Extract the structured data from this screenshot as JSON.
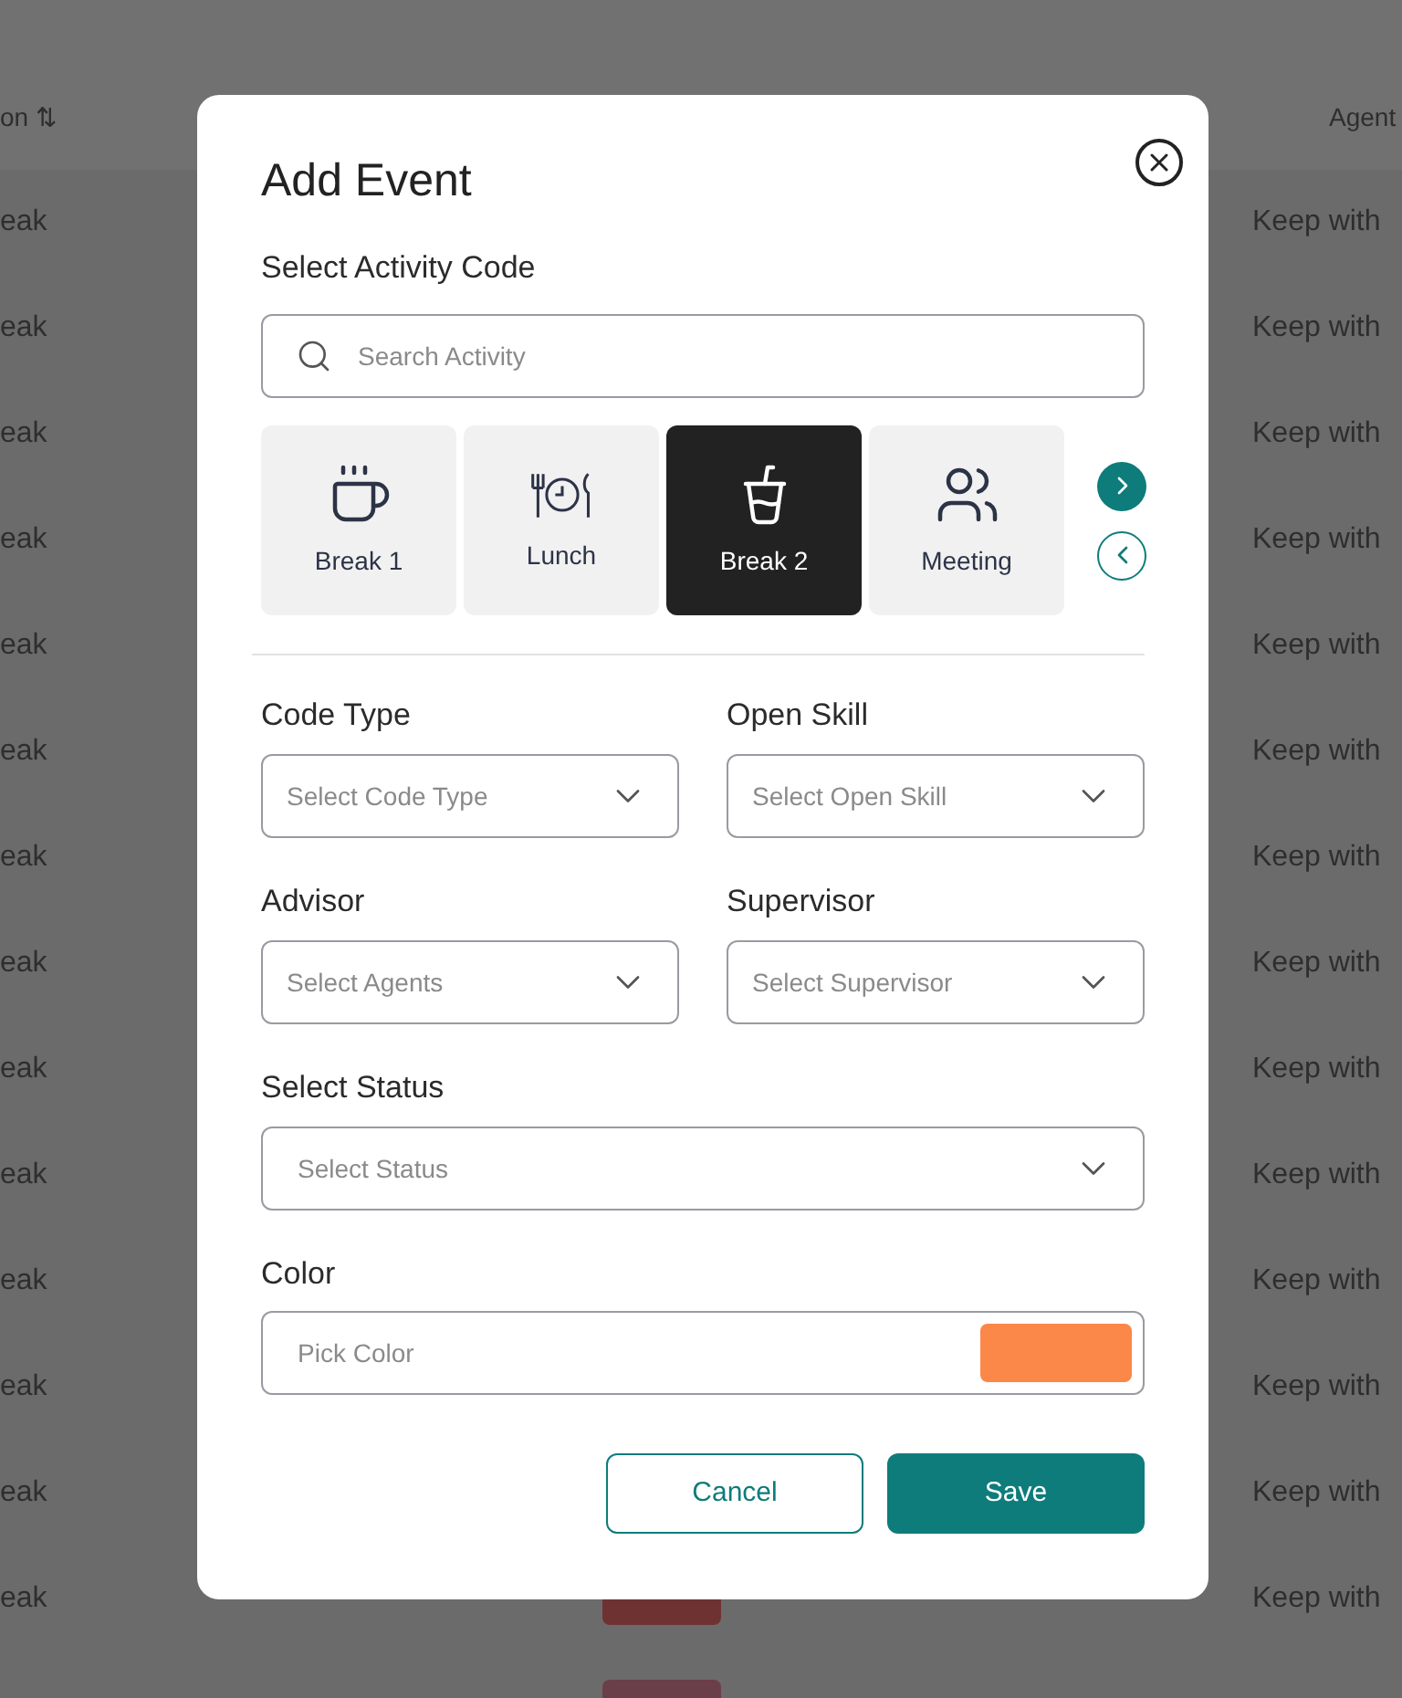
{
  "background_table": {
    "header": {
      "column_1": "on ⇅",
      "column_4": "Agent"
    },
    "rows": [
      {
        "column_1": "eak",
        "column_4": "Keep with"
      },
      {
        "column_1": "eak",
        "column_4": "Keep with"
      },
      {
        "column_1": "eak",
        "column_4": "Keep with"
      },
      {
        "column_1": "eak",
        "column_4": "Keep with"
      },
      {
        "column_1": "eak",
        "column_4": "Keep with"
      },
      {
        "column_1": "eak",
        "column_4": "Keep with"
      },
      {
        "column_1": "eak",
        "column_4": "Keep with"
      },
      {
        "column_1": "eak",
        "column_4": "Keep with"
      },
      {
        "column_1": "eak",
        "column_4": "Keep with"
      },
      {
        "column_1": "eak",
        "column_4": "Keep with"
      },
      {
        "column_1": "eak",
        "column_4": "Keep with"
      },
      {
        "column_1": "eak",
        "column_4": "Keep with"
      },
      {
        "column_1": "eak",
        "column_4": "Keep with"
      },
      {
        "column_1": "eak",
        "color": "#6f3232",
        "column_4": "Keep with"
      },
      {
        "color": "#6b3f4a"
      }
    ]
  },
  "dialog": {
    "title": "Add Event",
    "activity_label": "Select Activity Code",
    "search": {
      "placeholder": "Search Activity"
    },
    "activities": [
      {
        "label": "Break 1",
        "kind": "coffee",
        "selected": false
      },
      {
        "label": "Lunch",
        "kind": "meal",
        "selected": false
      },
      {
        "label": "Break 2",
        "kind": "drink",
        "selected": true
      },
      {
        "label": "Meeting",
        "kind": "meeting",
        "selected": false
      }
    ],
    "fields": [
      {
        "label": "Code Type",
        "placeholder": "Select Code Type"
      },
      {
        "label": "Open Skill",
        "placeholder": "Select Open Skill"
      },
      {
        "label": "Advisor",
        "placeholder": "Select Agents"
      },
      {
        "label": "Supervisor",
        "placeholder": "Select Supervisor"
      }
    ],
    "status": {
      "label": "Select Status",
      "placeholder": "Select Status"
    },
    "color": {
      "label": "Color",
      "placeholder": "Pick Color",
      "color": "#fb8748"
    },
    "buttons": {
      "cancel": "Cancel",
      "save": "Save"
    }
  }
}
